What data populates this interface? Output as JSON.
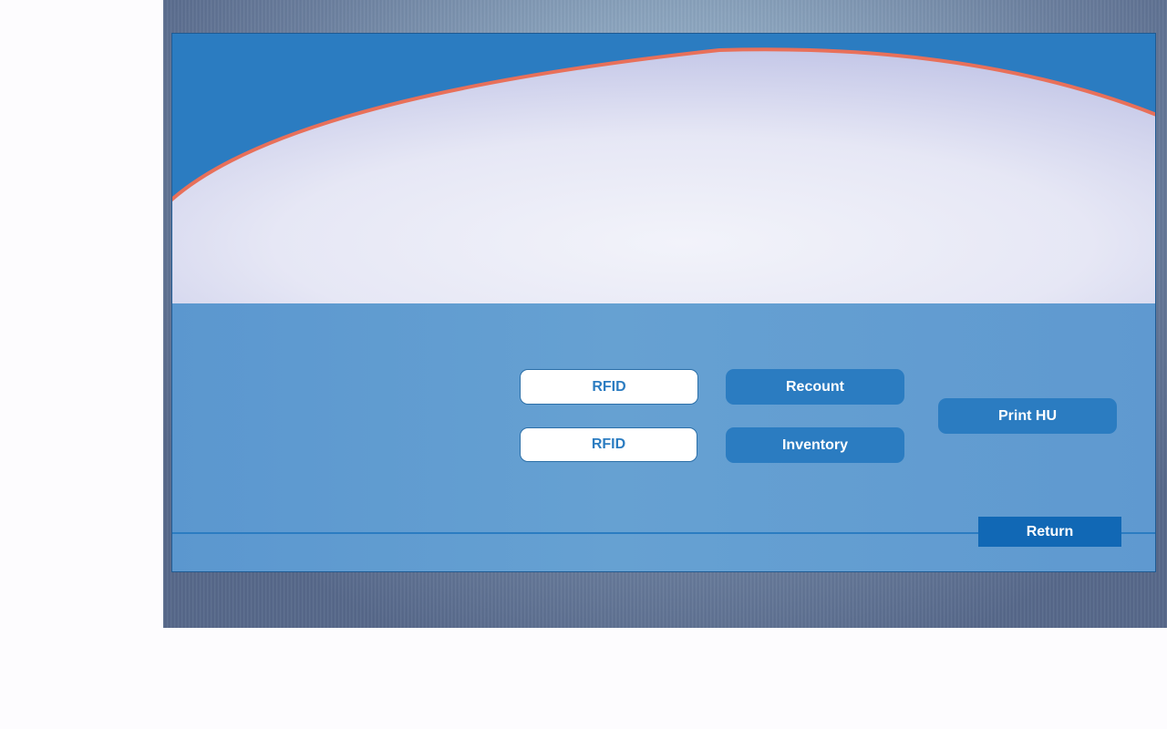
{
  "buttons": {
    "rfid_1": "RFID",
    "rfid_2": "RFID",
    "recount": "Recount",
    "inventory": "Inventory",
    "print_hu": "Print HU",
    "return": "Return"
  },
  "colors": {
    "accent_blue": "#2b7cc1",
    "panel_blue": "#5a9bd2",
    "return_blue": "#1168b5",
    "arc_stroke": "#e8705a",
    "dome_light": "#f0f1f9",
    "dome_edge": "#c7cae9"
  }
}
